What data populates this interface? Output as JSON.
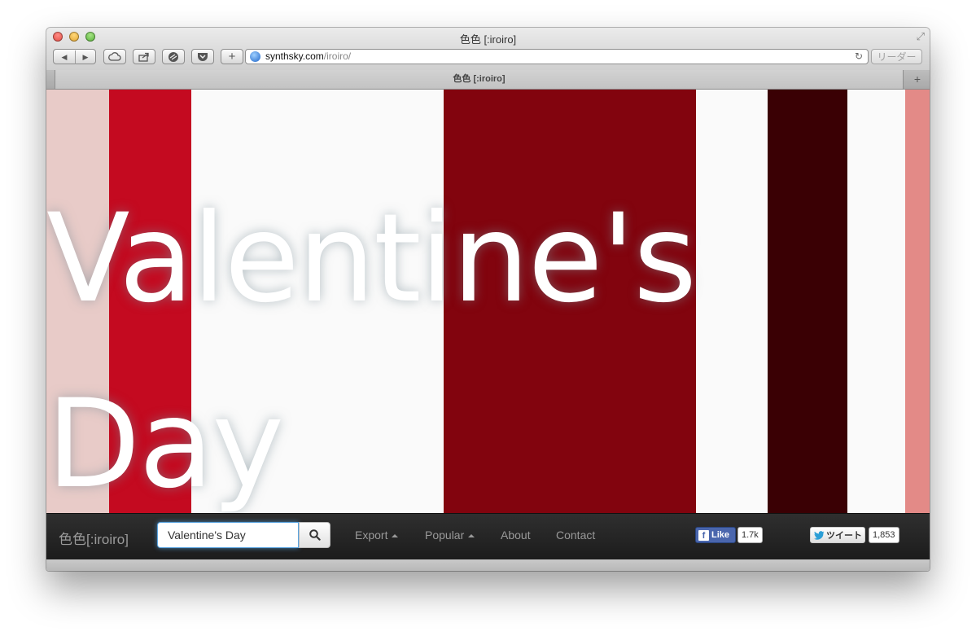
{
  "window": {
    "title": "色色 [:iroiro]"
  },
  "toolbar": {
    "back_glyph": "◀",
    "forward_glyph": "▶",
    "buttons": [
      "cloud-icon",
      "share-icon",
      "layers-icon",
      "pocket-icon"
    ],
    "add_glyph": "+"
  },
  "address": {
    "host": "synthsky.com",
    "path": "/iroiro/",
    "reader_label": "リーダー"
  },
  "tab": {
    "title": "色色 [:iroiro]",
    "new_tab_glyph": "+"
  },
  "palette": {
    "colors": [
      "#e8cbc8",
      "#c40a20",
      "#fafafa",
      "#fafafa",
      "#82040e",
      "#fafafa",
      "#3a0004",
      "#fafafa",
      "#e38a87"
    ]
  },
  "headline": {
    "line1": "Valentine's",
    "line2": "Day"
  },
  "navbar": {
    "brand": "色色[:iroiro]",
    "search_value": "Valentine's Day",
    "links": {
      "export": "Export",
      "popular": "Popular",
      "about": "About",
      "contact": "Contact"
    },
    "facebook": {
      "label": "Like",
      "count": "1.7k"
    },
    "twitter": {
      "label": "ツイート",
      "count": "1,853"
    }
  }
}
